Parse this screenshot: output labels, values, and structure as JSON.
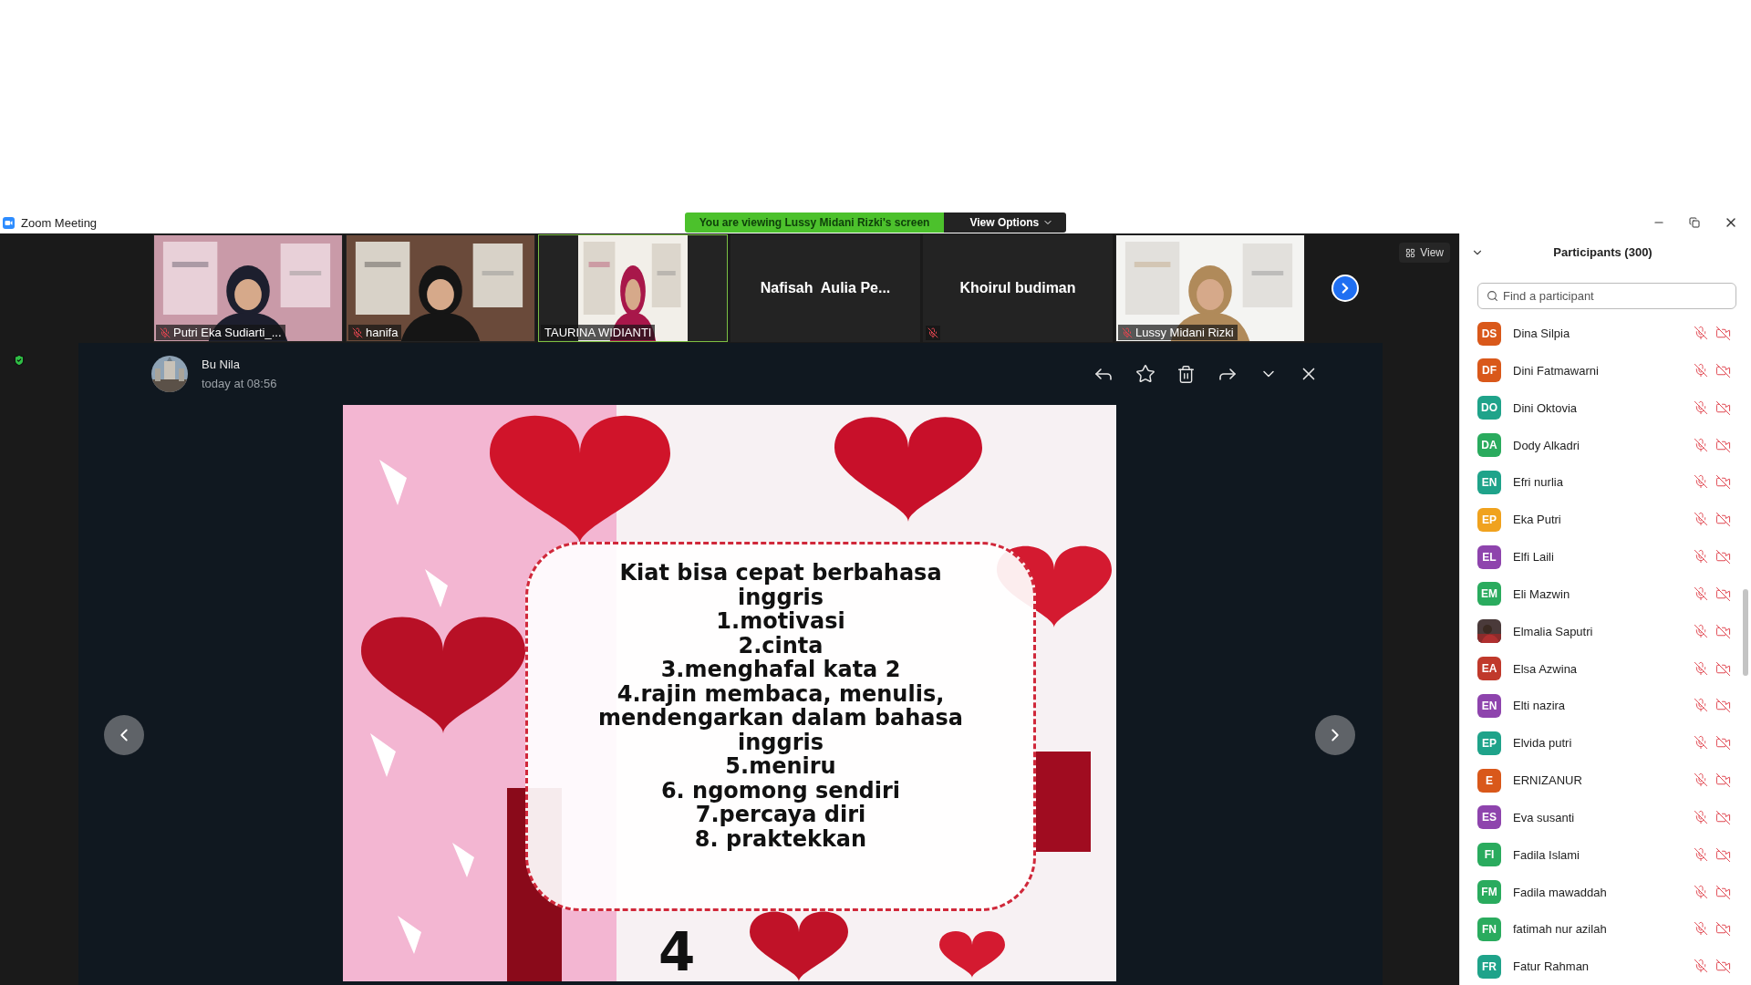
{
  "window": {
    "title": "Zoom Meeting"
  },
  "share_banner": {
    "text": "You are viewing Lussy Midani Rizki's screen",
    "button": "View Options"
  },
  "video_strip": {
    "tiles": [
      {
        "kind": "video",
        "name": "Putri Eka Sudiarti_...",
        "muted": true,
        "speaking": false
      },
      {
        "kind": "video",
        "name": "hanifa",
        "muted": true,
        "speaking": false
      },
      {
        "kind": "video",
        "name": "TAURINA WIDIANTI",
        "muted": false,
        "speaking": true
      },
      {
        "kind": "name",
        "name": "Nafisah  Aulia Pe...",
        "muted": false,
        "speaking": false
      },
      {
        "kind": "name",
        "name": "Khoirul budiman",
        "muted": true,
        "speaking": false
      },
      {
        "kind": "video",
        "name": "Lussy Midani Rizki",
        "muted": true,
        "speaking": false
      }
    ],
    "view_button": "View"
  },
  "viewer": {
    "sender": "Bu Nila",
    "time": "today at 08:56",
    "slide": {
      "lines": [
        "Kiat bisa cepat berbahasa",
        "inggris",
        "1.motivasi",
        "2.cinta",
        "3.menghafal kata 2",
        "4.rajin membaca, menulis,",
        "mendengarkan dalam bahasa",
        "inggris",
        "5.meniru",
        "6. ngomong sendiri",
        "7.percaya diri",
        "8. praktekkan"
      ],
      "page": "4"
    }
  },
  "participants": {
    "title": "Participants (300)",
    "search": {
      "placeholder": "Find a participant"
    },
    "items": [
      {
        "kind": "initials",
        "initials": "DS",
        "name": "Dina Silpia",
        "color": "#d9581a"
      },
      {
        "kind": "initials",
        "initials": "DF",
        "name": "Dini Fatmawarni",
        "color": "#d9581a"
      },
      {
        "kind": "initials",
        "initials": "DO",
        "name": "Dini Oktovia",
        "color": "#1fa38a"
      },
      {
        "kind": "initials",
        "initials": "DA",
        "name": "Dody Alkadri",
        "color": "#2aab5e"
      },
      {
        "kind": "initials",
        "initials": "EN",
        "name": "Efri nurlia",
        "color": "#1fa38a"
      },
      {
        "kind": "initials",
        "initials": "EP",
        "name": "Eka Putri",
        "color": "#f0a21e"
      },
      {
        "kind": "initials",
        "initials": "EL",
        "name": "Elfi Laili",
        "color": "#8e44ad"
      },
      {
        "kind": "initials",
        "initials": "EM",
        "name": "Eli Mazwin",
        "color": "#2aab5e"
      },
      {
        "name": "Elmalia Saputri"
      },
      {
        "kind": "initials",
        "initials": "EA",
        "name": "Elsa Azwina",
        "color": "#c0392b"
      },
      {
        "kind": "initials",
        "initials": "EN",
        "name": "Elti nazira",
        "color": "#8e44ad"
      },
      {
        "kind": "initials",
        "initials": "EP",
        "name": "Elvida putri",
        "color": "#1fa38a"
      },
      {
        "kind": "initials",
        "initials": "E",
        "name": "ERNIZANUR",
        "color": "#d9581a"
      },
      {
        "kind": "initials",
        "initials": "ES",
        "name": "Eva susanti",
        "color": "#8e44ad"
      },
      {
        "kind": "initials",
        "initials": "FI",
        "name": "Fadila Islami",
        "color": "#2aab5e"
      },
      {
        "kind": "initials",
        "initials": "FM",
        "name": "Fadila mawaddah",
        "color": "#2aab5e"
      },
      {
        "kind": "initials",
        "initials": "FN",
        "name": "fatimah nur azilah",
        "color": "#2aab5e"
      },
      {
        "kind": "initials",
        "initials": "FR",
        "name": "Fatur Rahman",
        "color": "#1fa38a"
      }
    ]
  }
}
